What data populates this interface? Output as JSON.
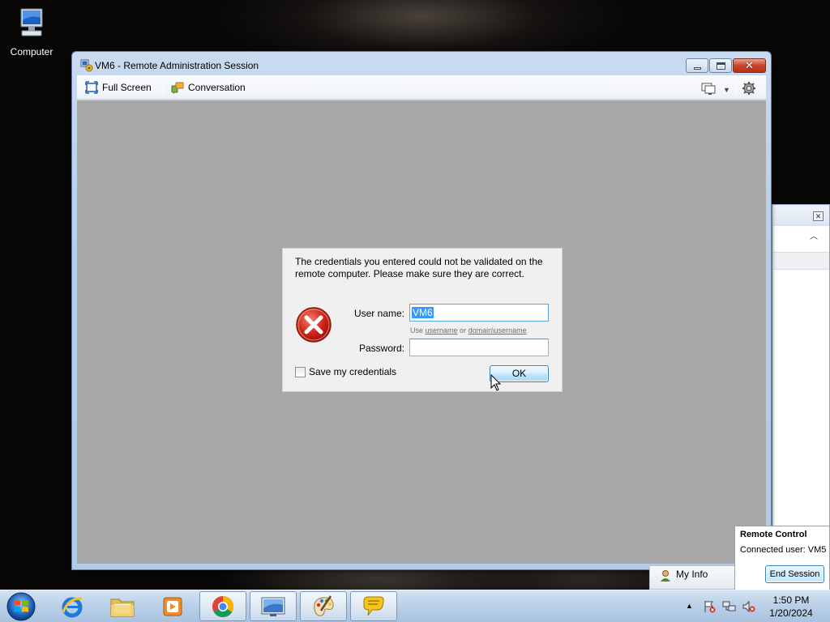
{
  "desktop": {
    "icons": [
      {
        "label": "Computer",
        "icon": "computer-icon"
      }
    ]
  },
  "window": {
    "title": "VM6 - Remote Administration Session",
    "caption_buttons": {
      "minimize": "minimize-icon",
      "maximize": "maximize-icon",
      "close": "✕"
    },
    "toolbar": {
      "full_screen_label": "Full Screen",
      "conversation_label": "Conversation",
      "monitor_icon": "monitor-icon",
      "dropdown_icon": "▼",
      "settings_icon": "gear-icon"
    }
  },
  "dialog": {
    "message": "The credentials you entered could not be validated on the remote computer. Please make sure they are correct.",
    "icon": "error-icon",
    "username_label": "User name:",
    "username_value": "VM6",
    "hint_prefix": "Use ",
    "hint_username": "username",
    "hint_or": " or ",
    "hint_domain": "domain\\username",
    "password_label": "Password:",
    "password_value": "",
    "save_label": "Save my credentials",
    "save_checked": false,
    "ok_label": "OK"
  },
  "notification": {
    "title": "Remote Control",
    "connected_user": "Connected user:  VM5",
    "end_session_label": "End Session"
  },
  "myinfo": {
    "label": "My Info"
  },
  "back_window": {
    "close_icon": "✕",
    "collapse_icon": "︿"
  },
  "taskbar": {
    "apps": [
      "internet-explorer",
      "windows-explorer",
      "media-player",
      "chrome",
      "remote-desktop-window",
      "paint",
      "chat"
    ],
    "clock_time": "1:50 PM",
    "clock_date": "1/20/2024",
    "show_hidden_icon": "▲"
  }
}
